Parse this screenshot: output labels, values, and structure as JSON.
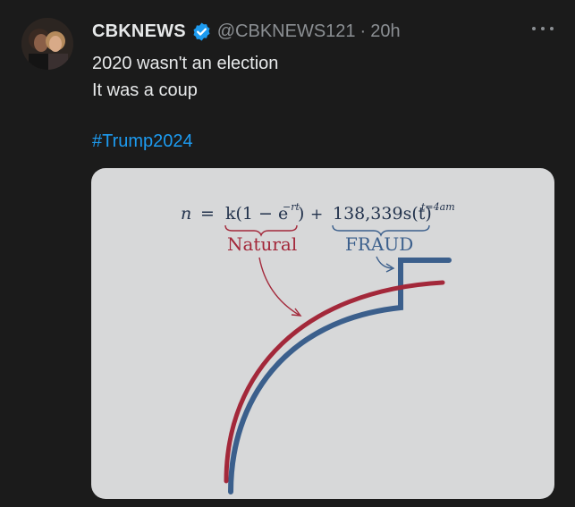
{
  "author": {
    "name": "CBKNEWS",
    "handle": "@CBKNEWS121",
    "separator": "·",
    "time": "20h",
    "verified_icon": "verified-badge-icon"
  },
  "post": {
    "lines": [
      "2020 wasn't an election",
      "It was a coup"
    ],
    "hashtag": "#Trump2024"
  },
  "media": {
    "equation": {
      "lhs": "n",
      "eq": "=",
      "natural_term": "k(1 − e",
      "natural_exp": "−rt",
      "natural_close": ")",
      "plus": "+",
      "fraud_term": "138,339s(t)",
      "fraud_exp": "t=4am"
    },
    "labels": {
      "natural": "Natural",
      "fraud": "FRAUD"
    },
    "colors": {
      "natural": "#a3283a",
      "fraud": "#3b5f8c",
      "background": "#d7d8d9"
    }
  },
  "icons": {
    "more": "more-options-icon"
  }
}
